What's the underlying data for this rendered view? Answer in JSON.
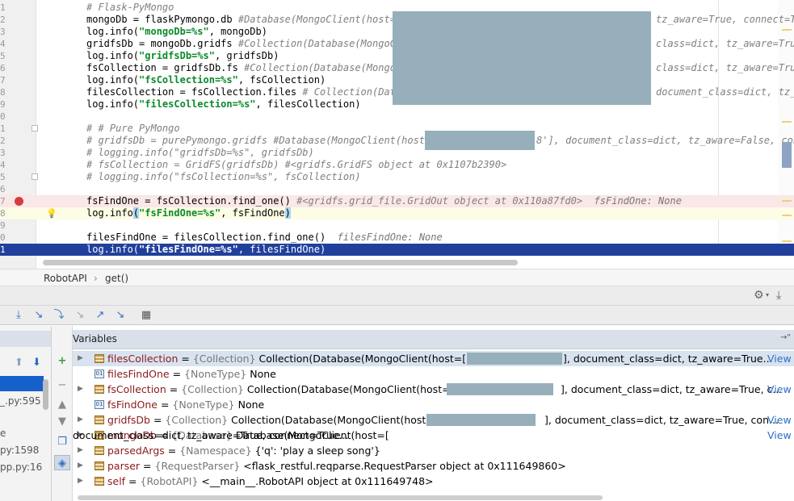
{
  "editor": {
    "lines": [
      {
        "num": "1",
        "code": "# Flask-PyMongo",
        "kind": "comment"
      },
      {
        "num": "2",
        "pre": "mongoDb = flaskPymongo.db ",
        "cm": "#Database(MongoClient(host=[",
        "tail": "tz_aware=True, connect=True"
      },
      {
        "num": "3",
        "pre": "log.info(",
        "str": "\"mongoDb=%s\"",
        "post": ", mongoDb)"
      },
      {
        "num": "4",
        "pre": "gridfsDb = mongoDb.gridfs ",
        "cm": "#Collection(Database(MongoCl",
        "tail": "class=dict, tz_aware=True,"
      },
      {
        "num": "5",
        "pre": "log.info(",
        "str": "\"gridfsDb=%s\"",
        "post": ", gridfsDb)"
      },
      {
        "num": "6",
        "pre": "fsCollection = gridfsDb.fs ",
        "cm": "#Collection(Database(MongoC",
        "tail": "class=dict, tz_aware=True,"
      },
      {
        "num": "7",
        "pre": "log.info(",
        "str": "\"fsCollection=%s\"",
        "post": ", fsCollection)"
      },
      {
        "num": "8",
        "pre": "filesCollection = fsCollection.files ",
        "cm": "# Collection(Datab",
        "tail": "document_class=dict, tz_"
      },
      {
        "num": "9",
        "pre": "log.info(",
        "str": "\"filesCollection=%s\"",
        "post": ", filesCollection)"
      },
      {
        "num": "0",
        "code": ""
      },
      {
        "num": "1",
        "code": "# # Pure PyMongo",
        "kind": "comment"
      },
      {
        "num": "2",
        "cm": "# gridfsDb = purePymongo.gridfs #Database(MongoClient(host=[",
        "tail": "8'], document_class=dict, tz_aware=False, conn"
      },
      {
        "num": "3",
        "code": "# logging.info(\"gridfsDb=%s\", gridfsDb)",
        "kind": "comment"
      },
      {
        "num": "4",
        "code": "# fsCollection = GridFS(gridfsDb) #<gridfs.GridFS object at 0x1107b2390>",
        "kind": "comment"
      },
      {
        "num": "5",
        "code": "# logging.info(\"fsCollection=%s\", fsCollection)",
        "kind": "comment"
      },
      {
        "num": "6",
        "code": ""
      },
      {
        "num": "7",
        "pre": "fsFindOne = fsCollection.find_one() ",
        "cm": "#<gridfs.grid_file.GridOut object at 0x110a87fd0>",
        "hint": "  fsFindOne: None",
        "kind": "breakpoint"
      },
      {
        "num": "8",
        "pre": "log.info",
        "brk": "(",
        "str": "\"fsFindOne=%s\"",
        "post": ", fsFindOne",
        "brk2": ")",
        "kind": "current"
      },
      {
        "num": "9",
        "code": ""
      },
      {
        "num": "0",
        "pre": "filesFindOne = filesCollection.find_one()",
        "hint": "  filesFindOne: None"
      },
      {
        "num": "1",
        "pre": "log.info(",
        "str": "\"filesFindOne=%s\"",
        "post": ", filesFindOne)",
        "kind": "selected"
      }
    ]
  },
  "breadcrumb": {
    "class_name": "RobotAPI",
    "separator": "›",
    "method": "get()"
  },
  "debug_toolbar": {
    "icons": [
      "show-execution-point-icon",
      "step-over-icon",
      "step-into-icon",
      "step-into-my-code-icon",
      "step-out-icon",
      "run-to-cursor-icon",
      "evaluate-expression-icon"
    ],
    "settings_glyph": "⚙",
    "pin_glyph": "⤓"
  },
  "variables": {
    "panel_title": "Variables",
    "header_arrow": "→\"",
    "frames": [
      {
        "label": "",
        "active": true
      },
      {
        "label": "_.py:595",
        "active": false
      },
      {
        "label": "",
        "active": false
      },
      {
        "label": "e",
        "active": false
      },
      {
        "label": "py:1598",
        "active": false
      },
      {
        "label": "pp.py:16",
        "active": false
      }
    ],
    "items": [
      {
        "name": "filesCollection",
        "type": "{Collection}",
        "value": "Collection(Database(MongoClient(host=['4",
        "tail": "], document_class=dict, tz_aware=True...",
        "view": "View",
        "expandable": true,
        "icon": "field"
      },
      {
        "name": "filesFindOne",
        "type": "{NoneType}",
        "value": "None",
        "tail": "",
        "view": "",
        "expandable": false,
        "icon": "none"
      },
      {
        "name": "fsCollection",
        "type": "{Collection}",
        "value": "Collection(Database(MongoClient(host=['",
        "tail": "], document_class=dict, tz_aware=True, c...",
        "view": "View",
        "expandable": true,
        "icon": "field"
      },
      {
        "name": "fsFindOne",
        "type": "{NoneType}",
        "value": "None",
        "tail": "",
        "view": "",
        "expandable": false,
        "icon": "none"
      },
      {
        "name": "gridfsDb",
        "type": "{Collection}",
        "value": "Collection(Database(MongoClient(host=[",
        "tail": "], document_class=dict, tz_aware=True, con...",
        "view": "View",
        "expandable": true,
        "icon": "field"
      },
      {
        "name": "mongoDb",
        "type": "{Database}",
        "value": "Database(MongoClient(host=[",
        "tail": "document_class=dict, tz_aware=True, connect=True...",
        "view": "View",
        "expandable": true,
        "icon": "field"
      },
      {
        "name": "parsedArgs",
        "type": "{Namespace}",
        "value": "{'q': 'play a sleep song'}",
        "tail": "",
        "view": "",
        "expandable": true,
        "icon": "field"
      },
      {
        "name": "parser",
        "type": "{RequestParser}",
        "value": "<flask_restful.reqparse.RequestParser object at 0x111649860>",
        "tail": "",
        "view": "",
        "expandable": true,
        "icon": "field"
      },
      {
        "name": "self",
        "type": "{RobotAPI}",
        "value": "<__main__.RobotAPI object at 0x111649748>",
        "tail": "",
        "view": "",
        "expandable": true,
        "icon": "field"
      }
    ]
  },
  "colors": {
    "selection": "#21409c",
    "breakpoint": "#d43d3d",
    "string": "#0a8a2a",
    "comment": "#808080",
    "redaction": "#97afbb"
  }
}
